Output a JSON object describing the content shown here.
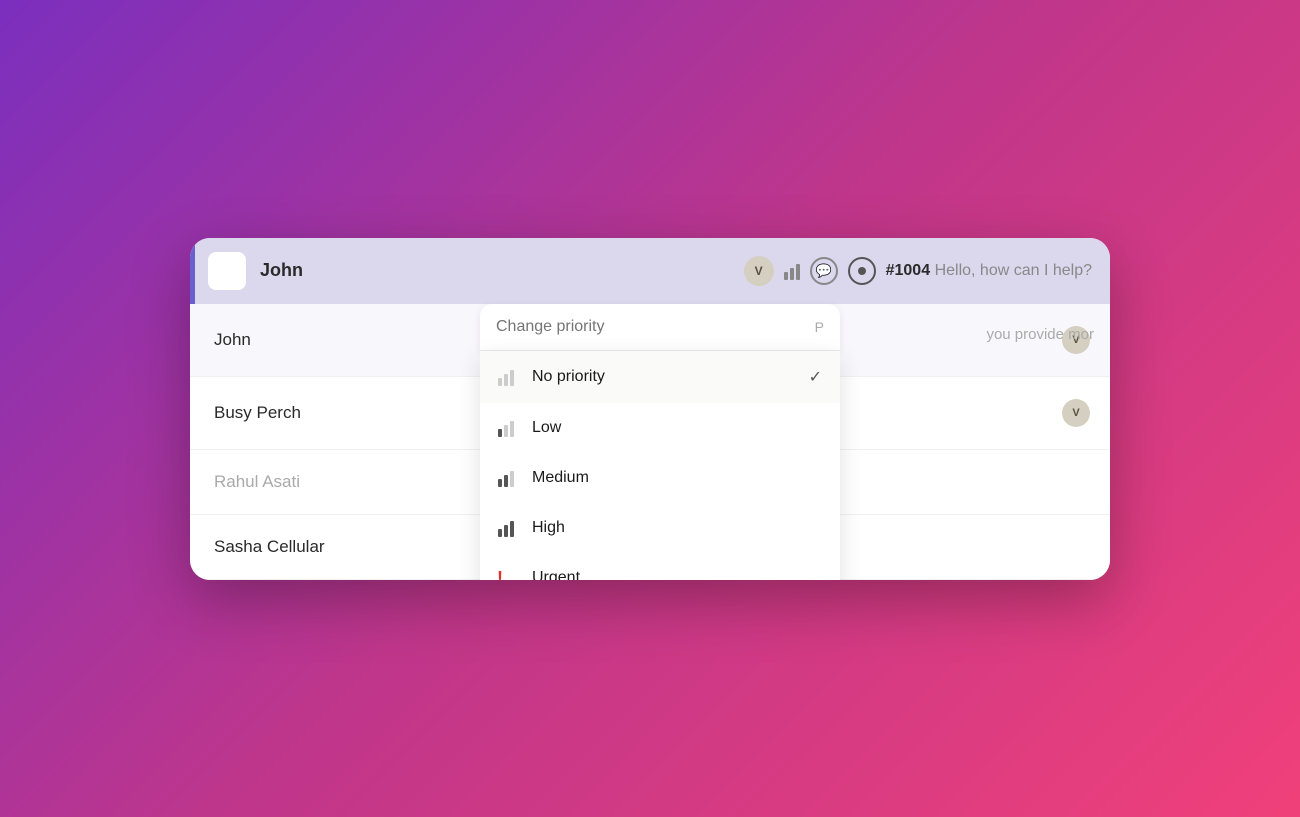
{
  "background": {
    "gradient": "linear-gradient(135deg, #7B2FBE 0%, #C0368A 50%, #F0407A 100%)"
  },
  "header": {
    "contact": "John",
    "ticket_id": "#1004",
    "ticket_message": "Hello, how can I help?",
    "agent_badge": "V"
  },
  "list": {
    "items": [
      {
        "name": "John",
        "badge": "V",
        "muted": false
      },
      {
        "name": "Busy Perch",
        "badge": "V",
        "muted": false
      },
      {
        "name": "Rahul Asati",
        "badge": "",
        "muted": true
      },
      {
        "name": "Sasha Cellular",
        "badge": "",
        "muted": false
      }
    ]
  },
  "dropdown": {
    "search_placeholder": "Change priority",
    "shortcut": "P",
    "options": [
      {
        "id": "no-priority",
        "label": "No priority",
        "icon_type": "bars-none",
        "selected": true
      },
      {
        "id": "low",
        "label": "Low",
        "icon_type": "bars-low",
        "selected": false
      },
      {
        "id": "medium",
        "label": "Medium",
        "icon_type": "bars-medium",
        "selected": false
      },
      {
        "id": "high",
        "label": "High",
        "icon_type": "bars-high",
        "selected": false
      },
      {
        "id": "urgent",
        "label": "Urgent",
        "icon_type": "urgent",
        "selected": false
      }
    ]
  },
  "right_preview": {
    "secondary_text": "you provide mor"
  }
}
